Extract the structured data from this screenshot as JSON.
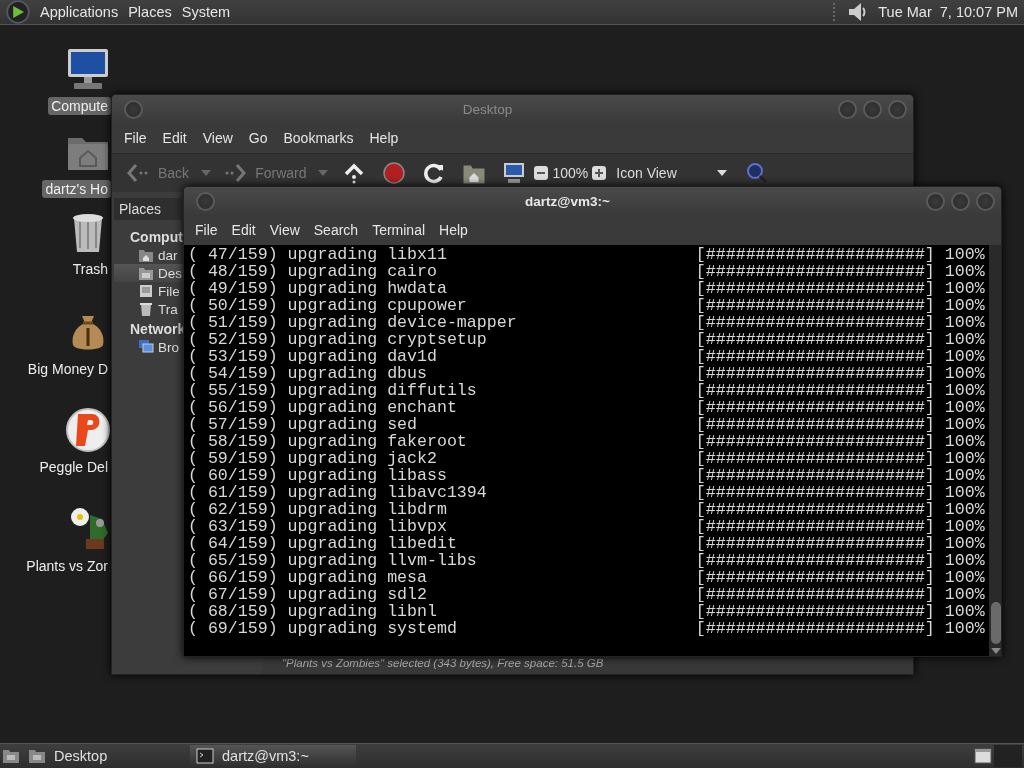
{
  "top_panel": {
    "menus": [
      "Applications",
      "Places",
      "System"
    ],
    "clock": "Tue Mar  7, 10:07 PM"
  },
  "desktop_icons": [
    {
      "label": "Compute",
      "kind": "computer",
      "selected": true
    },
    {
      "label": "dartz's Ho",
      "kind": "home",
      "selected": true
    },
    {
      "label": "Trash",
      "kind": "trash",
      "selected": false
    },
    {
      "label": "Big Money D",
      "kind": "moneybag",
      "selected": false
    },
    {
      "label": "Peggle Del",
      "kind": "ball",
      "selected": false
    },
    {
      "label": "Plants vs Zor",
      "kind": "flower",
      "selected": false
    }
  ],
  "file_manager": {
    "title": "Desktop",
    "menu": [
      "File",
      "Edit",
      "View",
      "Go",
      "Bookmarks",
      "Help"
    ],
    "toolbar": {
      "back": {
        "label": "Back",
        "disabled": true
      },
      "forward": {
        "label": "Forward",
        "disabled": true
      },
      "zoom": "100%",
      "view": "Icon View"
    },
    "sidebar": {
      "header": "Places",
      "sections": [
        {
          "title": "Comput",
          "items": [
            {
              "label": "dar",
              "kind": "home",
              "selected": false
            },
            {
              "label": "Des",
              "kind": "desktop",
              "selected": true
            },
            {
              "label": "File",
              "kind": "drive",
              "selected": false
            },
            {
              "label": "Tra",
              "kind": "trash",
              "selected": false
            }
          ]
        },
        {
          "title": "Network",
          "items": [
            {
              "label": "Bro",
              "kind": "network",
              "selected": false
            }
          ]
        }
      ]
    },
    "status": "\"Plants vs Zombies\" selected (343 bytes), Free space: 51.5 GB"
  },
  "terminal": {
    "title": "dartz@vm3:~",
    "menu": [
      "File",
      "Edit",
      "View",
      "Search",
      "Terminal",
      "Help"
    ],
    "lines": [
      {
        "text": "( 47/159) upgrading libx11",
        "progress": "[######################]",
        "percent": "100%"
      },
      {
        "text": "( 48/159) upgrading cairo",
        "progress": "[######################]",
        "percent": "100%"
      },
      {
        "text": "( 49/159) upgrading hwdata",
        "progress": "[######################]",
        "percent": "100%"
      },
      {
        "text": "( 50/159) upgrading cpupower",
        "progress": "[######################]",
        "percent": "100%"
      },
      {
        "text": "( 51/159) upgrading device-mapper",
        "progress": "[######################]",
        "percent": "100%"
      },
      {
        "text": "( 52/159) upgrading cryptsetup",
        "progress": "[######################]",
        "percent": "100%"
      },
      {
        "text": "( 53/159) upgrading dav1d",
        "progress": "[######################]",
        "percent": "100%"
      },
      {
        "text": "( 54/159) upgrading dbus",
        "progress": "[######################]",
        "percent": "100%"
      },
      {
        "text": "( 55/159) upgrading diffutils",
        "progress": "[######################]",
        "percent": "100%"
      },
      {
        "text": "( 56/159) upgrading enchant",
        "progress": "[######################]",
        "percent": "100%"
      },
      {
        "text": "( 57/159) upgrading sed",
        "progress": "[######################]",
        "percent": "100%"
      },
      {
        "text": "( 58/159) upgrading fakeroot",
        "progress": "[######################]",
        "percent": "100%"
      },
      {
        "text": "( 59/159) upgrading jack2",
        "progress": "[######################]",
        "percent": "100%"
      },
      {
        "text": "( 60/159) upgrading libass",
        "progress": "[######################]",
        "percent": "100%"
      },
      {
        "text": "( 61/159) upgrading libavc1394",
        "progress": "[######################]",
        "percent": "100%"
      },
      {
        "text": "( 62/159) upgrading libdrm",
        "progress": "[######################]",
        "percent": "100%"
      },
      {
        "text": "( 63/159) upgrading libvpx",
        "progress": "[######################]",
        "percent": "100%"
      },
      {
        "text": "( 64/159) upgrading libedit",
        "progress": "[######################]",
        "percent": "100%"
      },
      {
        "text": "( 65/159) upgrading llvm-libs",
        "progress": "[######################]",
        "percent": "100%"
      },
      {
        "text": "( 66/159) upgrading mesa",
        "progress": "[######################]",
        "percent": "100%"
      },
      {
        "text": "( 67/159) upgrading sdl2",
        "progress": "[######################]",
        "percent": "100%"
      },
      {
        "text": "( 68/159) upgrading libnl",
        "progress": "[######################]",
        "percent": "100%"
      },
      {
        "text": "( 69/159) upgrading systemd",
        "progress": "[######################]",
        "percent": "100%"
      }
    ]
  },
  "bottom_panel": {
    "tasks": [
      {
        "label": "Desktop",
        "kind": "folder",
        "selected": false
      },
      {
        "label": "dartz@vm3:~",
        "kind": "terminal",
        "selected": true
      }
    ]
  }
}
